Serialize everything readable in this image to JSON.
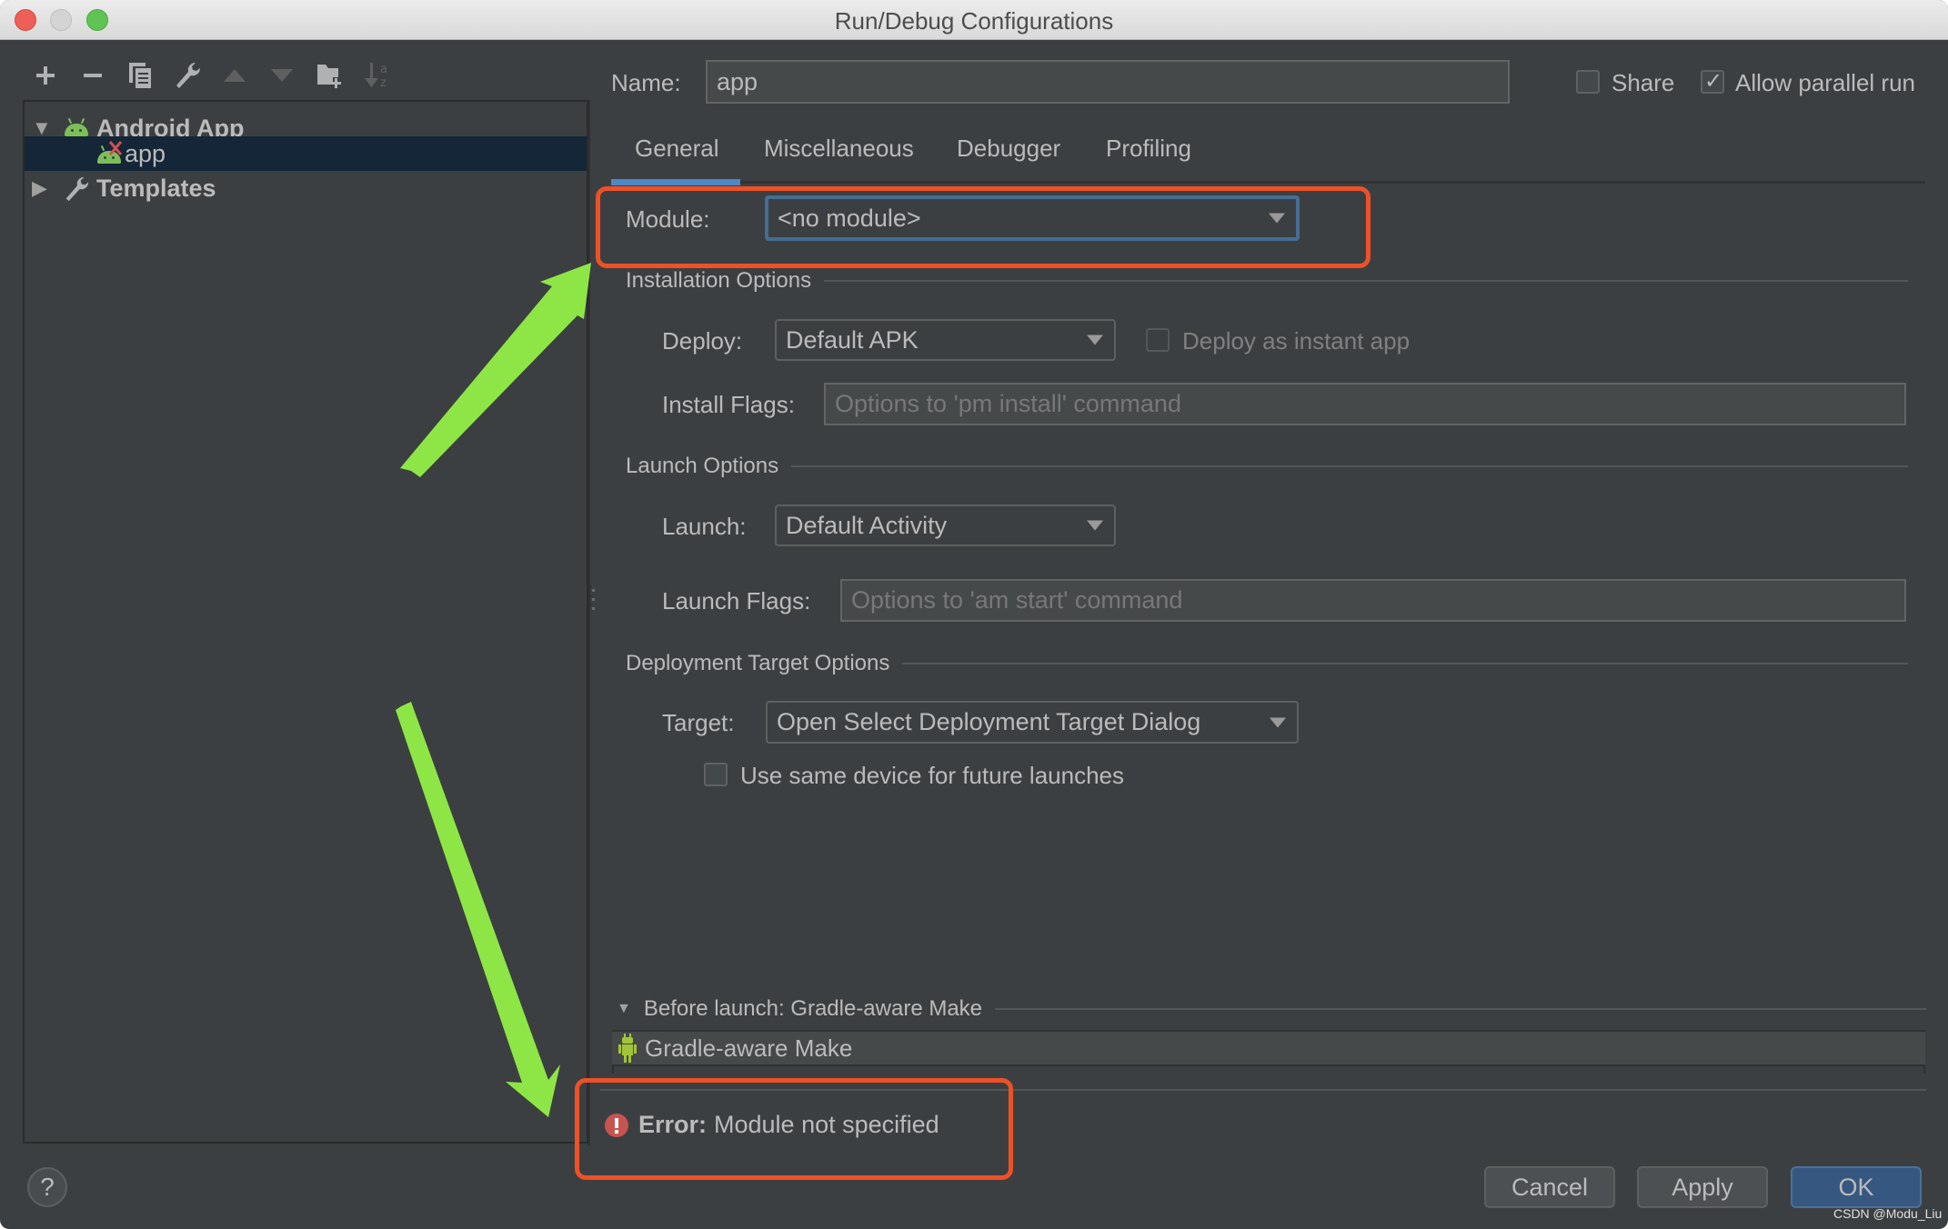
{
  "window": {
    "title": "Run/Debug Configurations",
    "traffic_lights": [
      "close",
      "minimize",
      "zoom"
    ]
  },
  "left_toolbar": {
    "icons": [
      {
        "name": "add",
        "glyph": "+",
        "enabled": true
      },
      {
        "name": "remove",
        "glyph": "−",
        "enabled": true
      },
      {
        "name": "copy",
        "glyph": "⧉",
        "enabled": true
      },
      {
        "name": "edit-defaults",
        "glyph": "🔧",
        "enabled": true
      },
      {
        "name": "move-up",
        "glyph": "▲",
        "enabled": false
      },
      {
        "name": "move-down",
        "glyph": "▼",
        "enabled": false
      },
      {
        "name": "new-folder",
        "glyph": "📁",
        "enabled": true
      },
      {
        "name": "sort",
        "glyph": "↓ᵃz",
        "enabled": false
      }
    ]
  },
  "tree": {
    "items": [
      {
        "label": "Android App",
        "level": 0,
        "expanded": true,
        "icon": "android-icon",
        "bold": true
      },
      {
        "label": "app",
        "level": 1,
        "selected": true,
        "icon": "android-error-icon"
      },
      {
        "label": "Templates",
        "level": 0,
        "expanded": false,
        "icon": "wrench-icon",
        "bold": true
      }
    ]
  },
  "header": {
    "name_label": "Name:",
    "name_value": "app",
    "share_label": "Share",
    "share_checked": false,
    "parallel_label": "Allow parallel run",
    "parallel_checked": true
  },
  "tabs": [
    {
      "label": "General",
      "active": true
    },
    {
      "label": "Miscellaneous",
      "active": false
    },
    {
      "label": "Debugger",
      "active": false
    },
    {
      "label": "Profiling",
      "active": false
    }
  ],
  "general": {
    "module_label": "Module:",
    "module_value": "<no module>",
    "installation_section": "Installation Options",
    "deploy_label": "Deploy:",
    "deploy_value": "Default APK",
    "instant_app_label": "Deploy as instant app",
    "instant_app_checked": false,
    "install_flags_label": "Install Flags:",
    "install_flags_placeholder": "Options to 'pm install' command",
    "launch_section": "Launch Options",
    "launch_label": "Launch:",
    "launch_value": "Default Activity",
    "launch_flags_label": "Launch Flags:",
    "launch_flags_placeholder": "Options to 'am start' command",
    "target_section": "Deployment Target Options",
    "target_label": "Target:",
    "target_value": "Open Select Deployment Target Dialog",
    "same_device_label": "Use same device for future launches",
    "same_device_checked": false
  },
  "before_launch": {
    "header": "Before launch: Gradle-aware Make",
    "items": [
      "Gradle-aware Make"
    ]
  },
  "error": {
    "prefix": "Error:",
    "message": "Module not specified"
  },
  "footer": {
    "help_glyph": "?",
    "cancel": "Cancel",
    "apply": "Apply",
    "ok": "OK"
  },
  "watermark": "CSDN @Modu_Liu",
  "annotation_colors": {
    "highlight": "#ee5127",
    "arrow": "#8ee646"
  }
}
